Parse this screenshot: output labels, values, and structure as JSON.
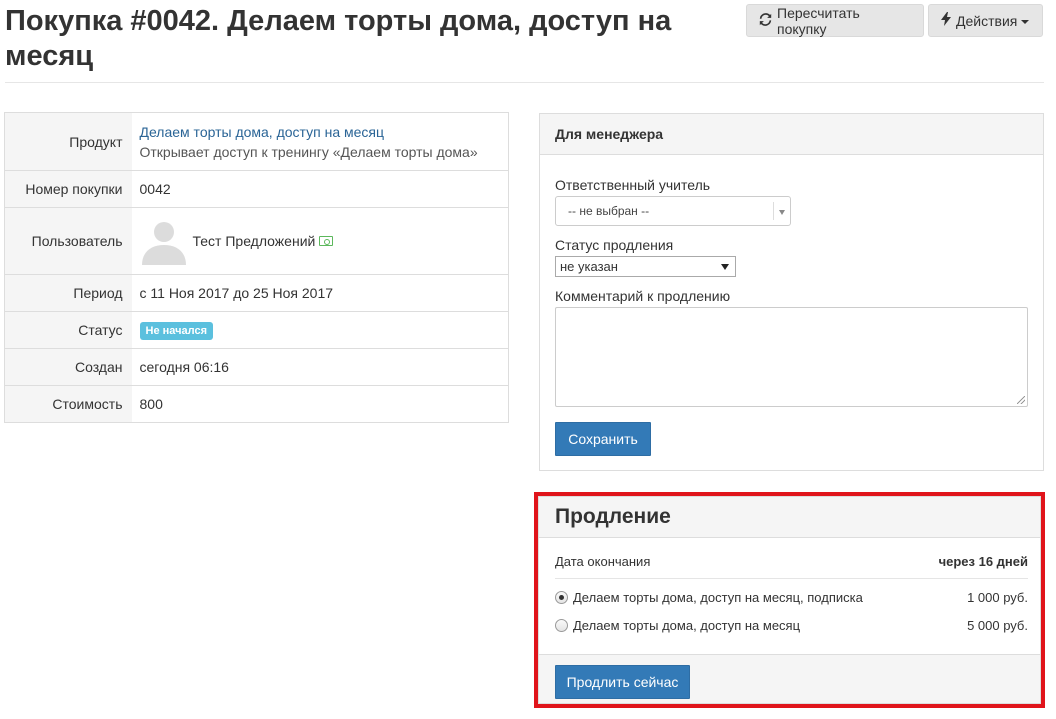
{
  "header": {
    "title": "Покупка #0042. Делаем торты дома, доступ на месяц",
    "recalc_label": "Пересчитать покупку",
    "actions_label": "Действия"
  },
  "info": {
    "product_key": "Продукт",
    "product_name": "Делаем торты дома, доступ на месяц",
    "product_desc": "Открывает доступ к тренингу «Делаем торты дома»",
    "number_key": "Номер покупки",
    "number_value": "0042",
    "user_key": "Пользователь",
    "user_name": "Тест Предложений",
    "period_key": "Период",
    "period_value": "с 11 Ноя 2017 до 25 Ноя 2017",
    "status_key": "Статус",
    "status_value": "Не начался",
    "created_key": "Создан",
    "created_value": "сегодня 06:16",
    "cost_key": "Стоимость",
    "cost_value": "800"
  },
  "manager": {
    "title": "Для менеджера",
    "teacher_label": "Ответственный учитель",
    "teacher_value": "-- не выбран --",
    "renewal_status_label": "Статус продления",
    "renewal_status_value": "не указан",
    "comment_label": "Комментарий к продлению",
    "comment_value": "",
    "save_label": "Сохранить"
  },
  "renewal": {
    "title": "Продление",
    "end_key": "Дата окончания",
    "end_value": "через 16 дней",
    "options": [
      {
        "name": "Делаем торты дома, доступ на месяц, подписка",
        "price": "1 000 руб.",
        "selected": true
      },
      {
        "name": "Делаем торты дома, доступ на месяц",
        "price": "5 000 руб.",
        "selected": false
      }
    ],
    "renew_label": "Продлить сейчас"
  },
  "colors": {
    "primary": "#337ab7",
    "link": "#2a6496",
    "status_badge": "#5bc0de",
    "highlight": "#e0141b"
  },
  "icons": {
    "recalc": "refresh-icon",
    "actions": "lightning-icon",
    "user": "avatar-placeholder",
    "money": "money-icon"
  }
}
